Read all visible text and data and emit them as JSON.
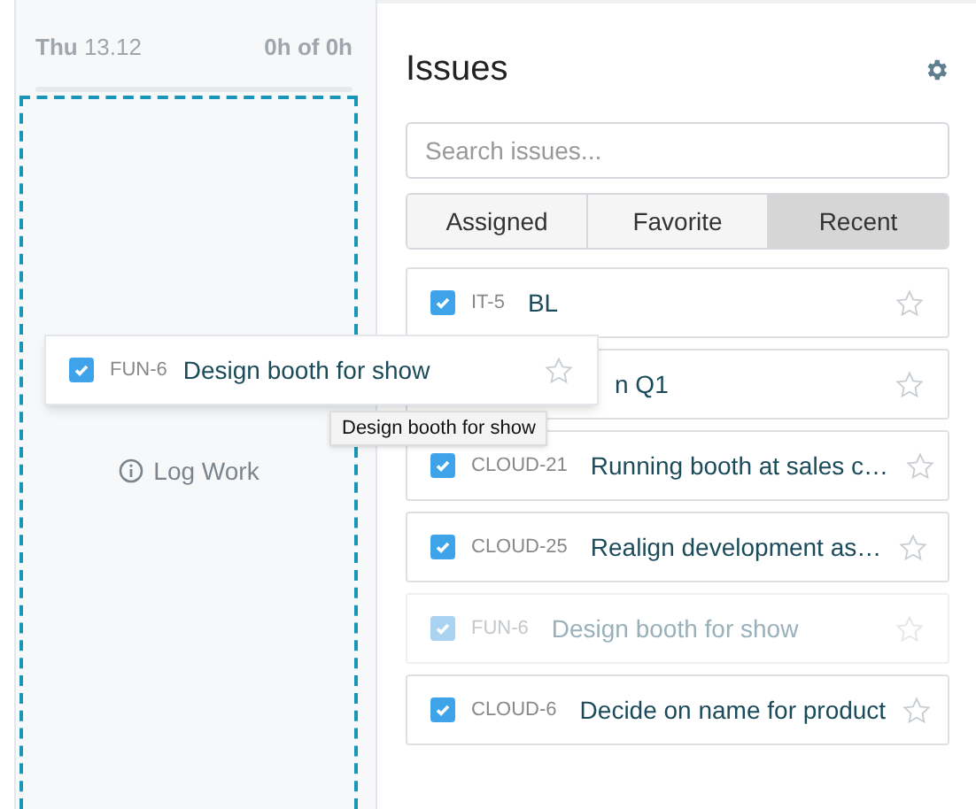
{
  "day": {
    "weekday": "Thu",
    "date": "13.12",
    "hours": "0h of 0h",
    "log_work": "Log Work"
  },
  "dragged_issue": {
    "key": "FUN-6",
    "title": "Design booth for show",
    "checked": true,
    "favorite": false
  },
  "tooltip": "Design booth for show",
  "panel": {
    "title": "Issues",
    "search": {
      "placeholder": "Search issues..."
    },
    "tabs": [
      {
        "label": "Assigned",
        "selected": false
      },
      {
        "label": "Favorite",
        "selected": false
      },
      {
        "label": "Recent",
        "selected": true
      }
    ],
    "issues": [
      {
        "kind": "full",
        "key": "IT-5",
        "title": "BL",
        "checked": true,
        "favorite": false,
        "disabled": false
      },
      {
        "kind": "covered",
        "title": "n Q1",
        "favorite": false,
        "disabled": false
      },
      {
        "kind": "full",
        "key": "CLOUD-21",
        "title": "Running booth at sales c…",
        "checked": true,
        "favorite": false,
        "disabled": false
      },
      {
        "kind": "full",
        "key": "CLOUD-25",
        "title": "Realign development as…",
        "checked": true,
        "favorite": false,
        "disabled": false
      },
      {
        "kind": "full",
        "key": "FUN-6",
        "title": "Design booth for show",
        "checked": true,
        "favorite": false,
        "disabled": true
      },
      {
        "kind": "full",
        "key": "CLOUD-6",
        "title": "Decide on name for product",
        "checked": true,
        "favorite": false,
        "disabled": false
      }
    ]
  }
}
